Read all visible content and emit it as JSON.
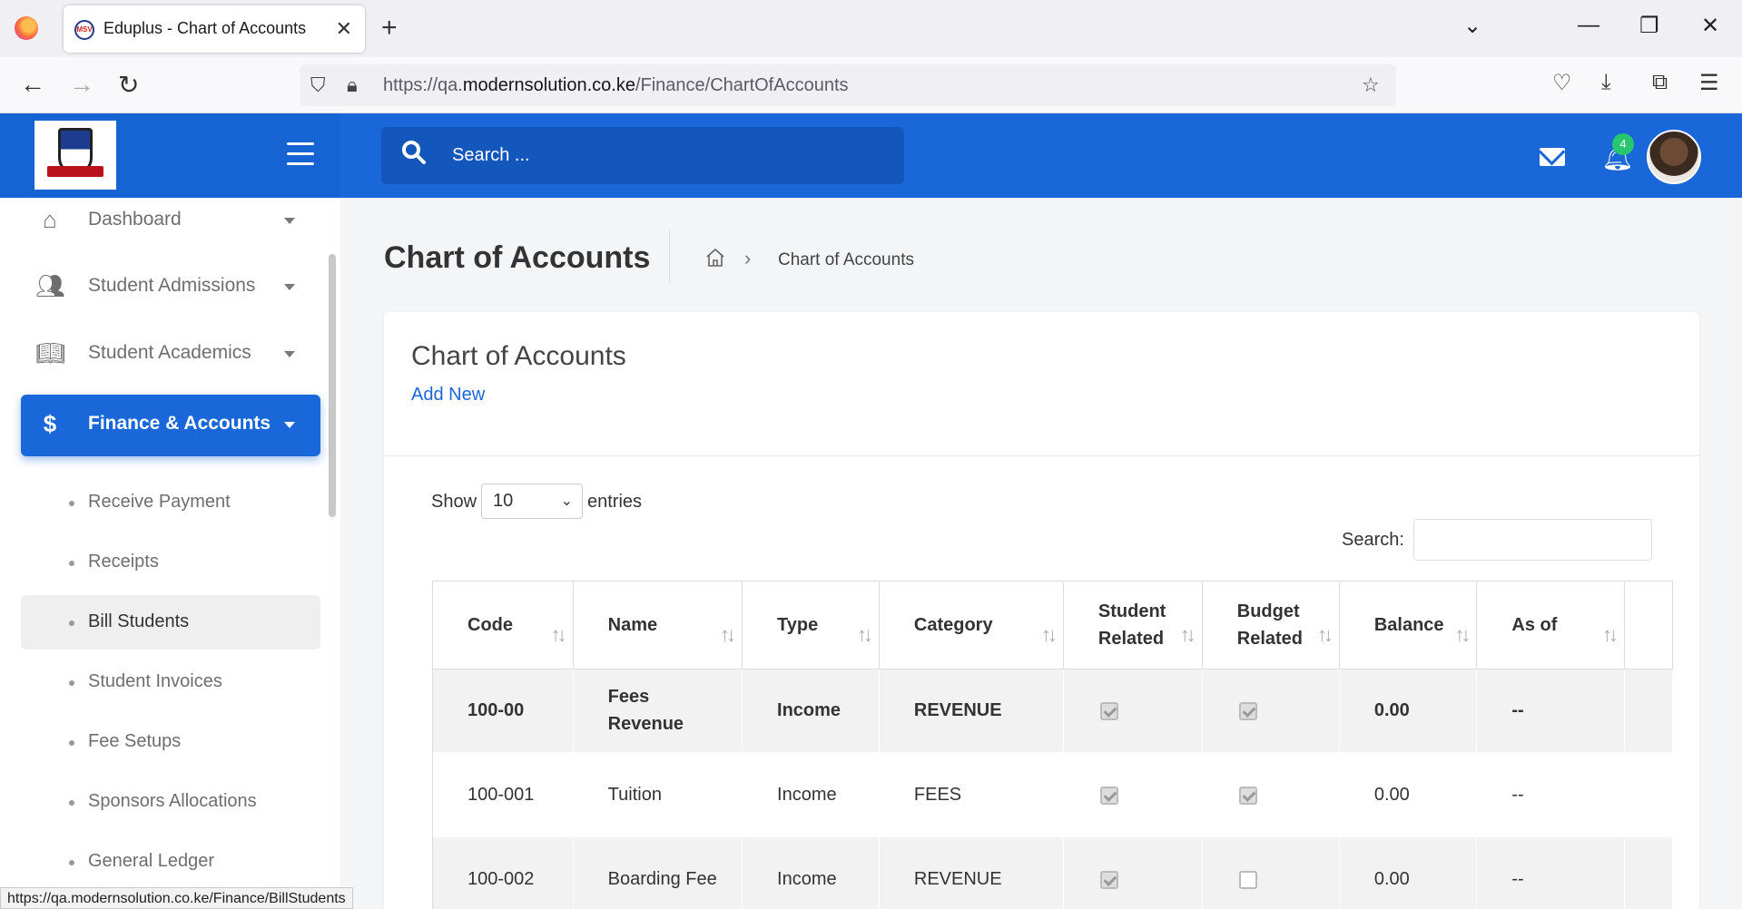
{
  "browser": {
    "tab_title": "Eduplus - Chart of Accounts",
    "tab_favicon_text": "MSV",
    "url_prefix": "https://qa.",
    "url_domain": "modernsolution.co.ke",
    "url_path": "/Finance/ChartOfAccounts",
    "status_link": "https://qa.modernsolution.co.ke/Finance/BillStudents"
  },
  "header": {
    "search_placeholder": "Search ...",
    "notification_count": "4"
  },
  "sidebar": {
    "items": [
      {
        "label": "Dashboard",
        "icon": "home-icon"
      },
      {
        "label": "Student Admissions",
        "icon": "users-icon"
      },
      {
        "label": "Student Academics",
        "icon": "book-icon"
      },
      {
        "label": "Finance & Accounts",
        "icon": "dollar-icon",
        "active": true
      }
    ],
    "sub_items": [
      {
        "label": "Receive Payment"
      },
      {
        "label": "Receipts"
      },
      {
        "label": "Bill Students",
        "hover": true
      },
      {
        "label": "Student Invoices"
      },
      {
        "label": "Fee Setups"
      },
      {
        "label": "Sponsors Allocations"
      },
      {
        "label": "General Ledger"
      }
    ]
  },
  "page": {
    "title": "Chart of Accounts",
    "breadcrumb_current": "Chart of Accounts"
  },
  "card": {
    "title": "Chart of Accounts",
    "add_new_label": "Add New",
    "show_label": "Show",
    "entries_value": "10",
    "entries_label": "entries",
    "search_label": "Search:"
  },
  "table": {
    "columns": [
      "Code",
      "Name",
      "Type",
      "Category",
      "Student Related",
      "Budget Related",
      "Balance",
      "As of"
    ],
    "rows": [
      {
        "code": "100-00",
        "name": "Fees Revenue",
        "type": "Income",
        "category": "REVENUE",
        "student_related": true,
        "budget_related": true,
        "balance": "0.00",
        "as_of": "--"
      },
      {
        "code": "100-001",
        "name": "Tuition",
        "type": "Income",
        "category": "FEES",
        "student_related": true,
        "budget_related": true,
        "balance": "0.00",
        "as_of": "--"
      },
      {
        "code": "100-002",
        "name": "Boarding Fee",
        "type": "Income",
        "category": "REVENUE",
        "student_related": true,
        "budget_related": false,
        "balance": "0.00",
        "as_of": "--"
      }
    ]
  },
  "colors": {
    "primary": "#1967d8",
    "header_search": "#1457bc",
    "badge": "#28c76f"
  }
}
